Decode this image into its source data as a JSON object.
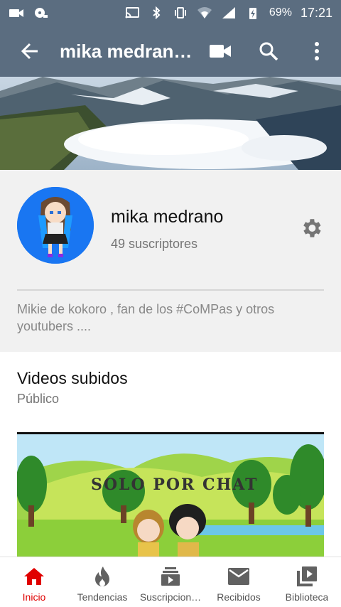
{
  "status_bar": {
    "battery": "69%",
    "time": "17:21"
  },
  "app_bar": {
    "title": "mika medrano…",
    "icons": [
      "back-arrow-icon",
      "video-camera-icon",
      "search-icon",
      "more-vert-icon"
    ]
  },
  "channel": {
    "name": "mika medrano",
    "subscribers": "49 suscriptores",
    "description": "Mikie de kokoro , fan de los #CoMPas y otros youtubers ...."
  },
  "section": {
    "title": "Videos subidos",
    "subtitle": "Público"
  },
  "video": {
    "thumb_title": "SOLO POR CHAT"
  },
  "bottom_nav": {
    "items": [
      {
        "label": "Inicio",
        "icon": "home-icon"
      },
      {
        "label": "Tendencias",
        "icon": "flame-icon"
      },
      {
        "label": "Suscripcion…",
        "icon": "subscriptions-icon"
      },
      {
        "label": "Recibidos",
        "icon": "mail-icon"
      },
      {
        "label": "Biblioteca",
        "icon": "library-icon"
      }
    ]
  },
  "colors": {
    "app_bar": "#5b6d80",
    "accent_red": "#e00000",
    "avatar_bg": "#1976f2"
  }
}
